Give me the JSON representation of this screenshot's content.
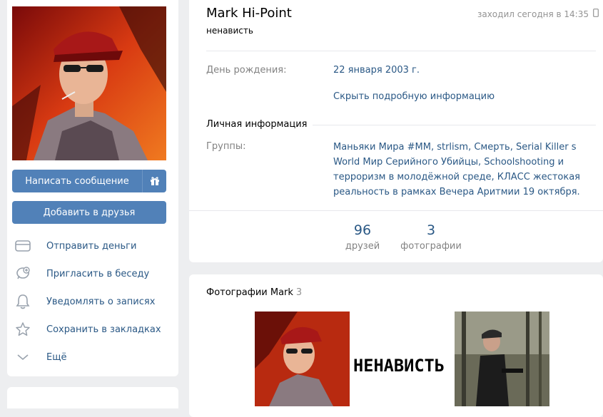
{
  "left": {
    "send_message": "Написать сообщение",
    "add_friend": "Добавить в друзья",
    "menu": [
      {
        "icon": "card-money-icon",
        "label": "Отправить деньги"
      },
      {
        "icon": "chat-plus-icon",
        "label": "Пригласить в беседу"
      },
      {
        "icon": "bell-icon",
        "label": "Уведомлять о записях"
      },
      {
        "icon": "star-icon",
        "label": "Сохранить в закладках"
      },
      {
        "icon": "chevron-down-icon",
        "label": "Ещё"
      }
    ]
  },
  "profile": {
    "name": "Mark Hi-Point",
    "status": "ненависть",
    "last_seen": "заходил сегодня в 14:35",
    "birthday_label": "День рождения:",
    "birthday_value": "22 января 2003 г.",
    "hide_info": "Скрыть подробную информацию",
    "personal_info_title": "Личная информация",
    "groups_label": "Группы:",
    "groups_value": "Маньяки Мира #MM, strlism, Смерть, Serial Killer s World Мир Серийного Убийцы, Schoolshooting и терроризм в молодёжной среде, КЛАСС жестокая реальность в рамках Вечера Аритмии 19 октября."
  },
  "counters": [
    {
      "num": "96",
      "cap": "друзей"
    },
    {
      "num": "3",
      "cap": "фотографии"
    }
  ],
  "photos": {
    "title": "Фотографии Mark",
    "count": "3",
    "text_photo": "НЕНАВИСТЬ"
  },
  "colors": {
    "accent": "#5181b8",
    "link": "#2a5885",
    "gray": "#828282",
    "bg": "#edeef0"
  }
}
